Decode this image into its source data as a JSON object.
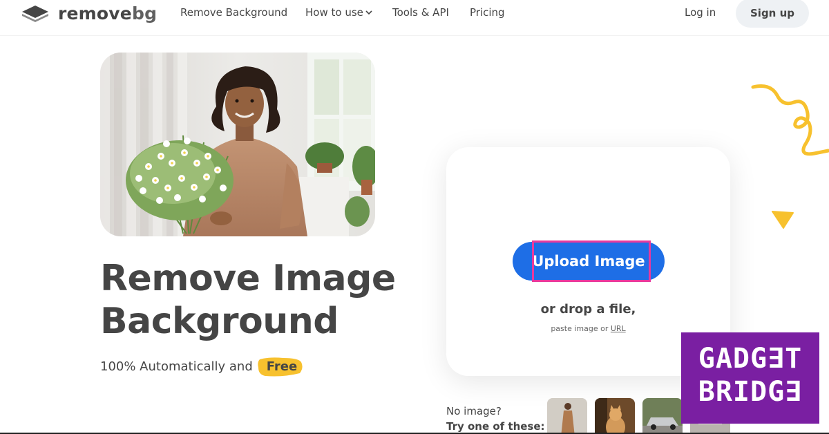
{
  "header": {
    "logo_text": "remove",
    "logo_text_suffix": "bg",
    "nav": [
      {
        "label": "Remove Background"
      },
      {
        "label": "How to use",
        "has_dropdown": true
      },
      {
        "label": "Tools & API"
      },
      {
        "label": "Pricing"
      }
    ],
    "login_label": "Log in",
    "signup_label": "Sign up"
  },
  "hero": {
    "headline_line1": "Remove Image",
    "headline_line2": "Background",
    "subline": "100% Automatically and",
    "badge": "Free"
  },
  "upload": {
    "button_label": "Upload Image",
    "drop_text": "or drop a file,",
    "paste_prefix": "paste image or",
    "paste_link": "URL"
  },
  "samples": {
    "line1": "No image?",
    "line2": "Try one of these:",
    "thumbs": [
      "woman-in-coat",
      "cat",
      "car",
      "product"
    ]
  },
  "watermark": {
    "line1": "GADG∃T",
    "line2": "BRIDG∃"
  },
  "colors": {
    "primary": "#1e6ee6",
    "highlight": "#e8399d",
    "accent_yellow": "#f7c12e",
    "text": "#454545",
    "watermark_bg": "#7a1fa2"
  }
}
